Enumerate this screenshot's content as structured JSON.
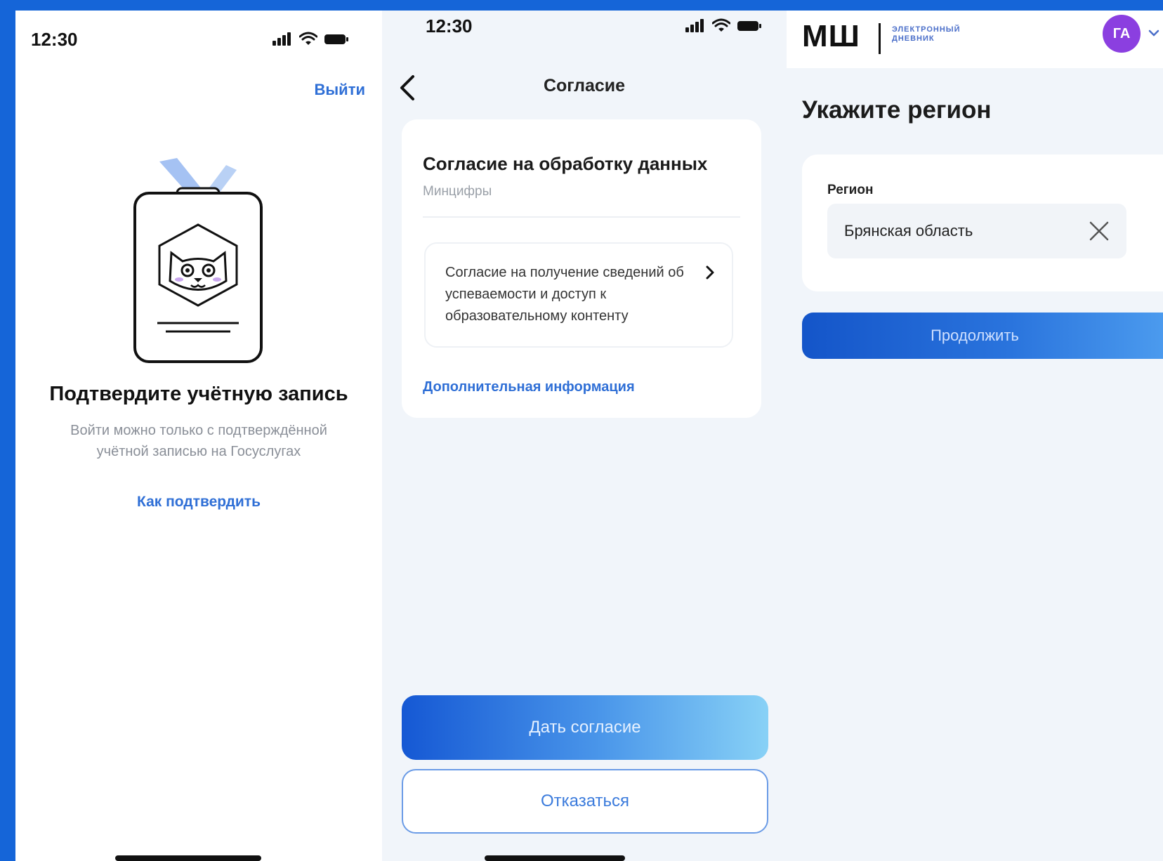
{
  "screen1": {
    "time": "12:30",
    "logout_label": "Выйти",
    "title": "Подтвердите учётную запись",
    "description": "Войти можно только с подтверждённой учётной записью на Госуслугах",
    "link_label": "Как подтвердить"
  },
  "screen2": {
    "time": "12:30",
    "header_title": "Согласие",
    "card": {
      "title": "Согласие на обработку данных",
      "subtitle": "Минцифры",
      "item_text": "Согласие на получение сведений об успеваемости и доступ к образовательному контенту",
      "more_info_label": "Дополнительная информация"
    },
    "agree_label": "Дать согласие",
    "decline_label": "Отказаться"
  },
  "screen3": {
    "logo_main": "МШ",
    "logo_sub_line1": "ЭЛЕКТРОННЫЙ",
    "logo_sub_line2": "ДНЕВНИК",
    "avatar_initials": "ГА",
    "title": "Укажите регион",
    "region_label": "Регион",
    "region_value": "Брянская область",
    "continue_label": "Продолжить"
  },
  "icons": {
    "back": "chevron-left-icon",
    "item_chevron": "chevron-right-icon",
    "clear": "close-icon",
    "avatar_menu": "chevron-down-icon",
    "status": [
      "cellular-signal-icon",
      "wifi-icon",
      "battery-icon"
    ]
  },
  "colors": {
    "background": "#1565d8",
    "link_blue": "#2f6fd6",
    "avatar_purple": "#8b3fe0",
    "button_gradient_start": "#1558d4",
    "button_gradient_end": "#88d1f6"
  }
}
